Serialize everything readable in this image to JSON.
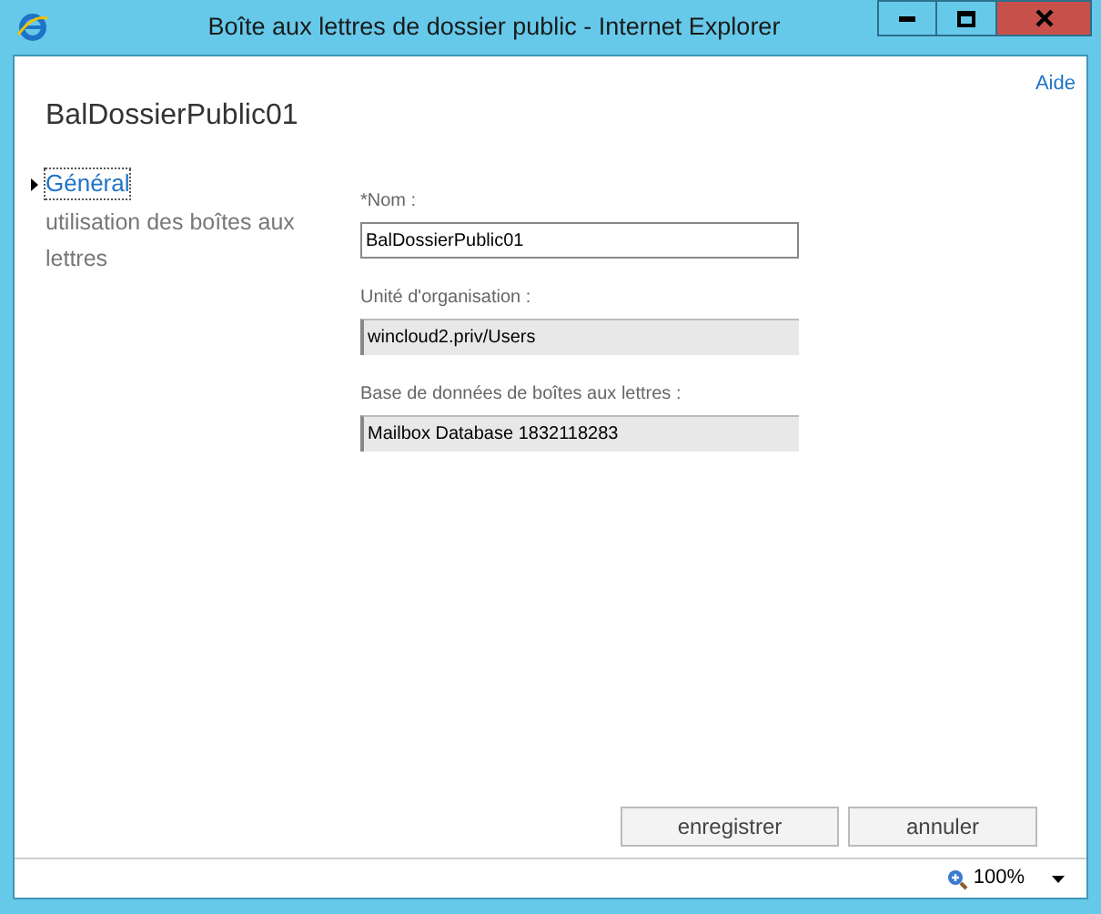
{
  "window": {
    "title": "Boîte aux lettres de dossier public - Internet Explorer"
  },
  "help_link": "Aide",
  "heading": "BalDossierPublic01",
  "nav": [
    {
      "label": "Général",
      "selected": true
    },
    {
      "label": "utilisation des boîtes aux lettres",
      "selected": false
    }
  ],
  "fields": [
    {
      "label": "*Nom :",
      "value": "BalDossierPublic01",
      "disabled": false
    },
    {
      "label": "Unité d'organisation :",
      "value": "wincloud2.priv/Users",
      "disabled": true
    },
    {
      "label": "Base de données de boîtes aux lettres :",
      "value": "Mailbox Database 1832118283",
      "disabled": true
    }
  ],
  "buttons": [
    "enregistrer",
    "annuler"
  ],
  "status_bar": {
    "zoom": "100%"
  }
}
